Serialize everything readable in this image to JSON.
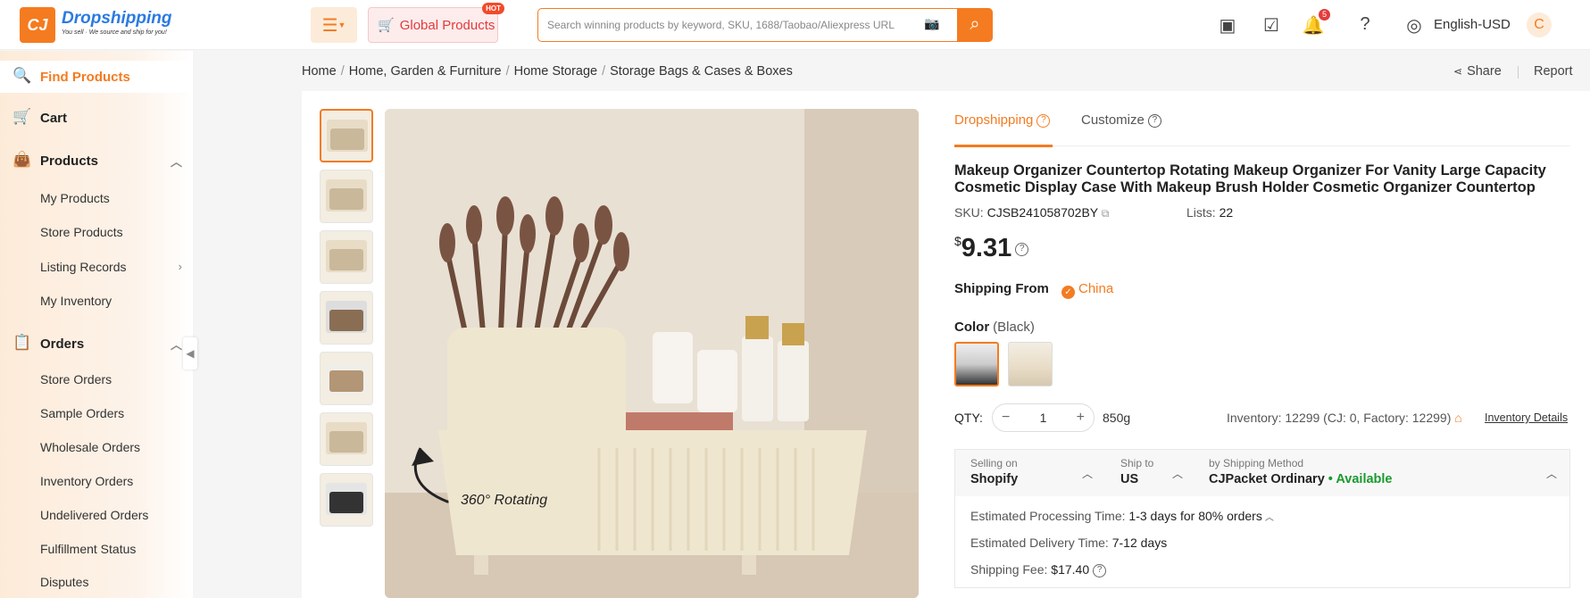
{
  "brand": {
    "name": "Dropshipping",
    "slogan": "You sell · We source and ship for you!",
    "logo_text": "CJ"
  },
  "header": {
    "global_products": "Global Products",
    "hot_badge": "HOT",
    "search_placeholder": "Search winning products by keyword, SKU, 1688/Taobao/Aliexpress URL",
    "notif_count": "5",
    "language": "English-USD",
    "avatar_letter": "C"
  },
  "sidebar": {
    "find_products": "Find Products",
    "cart": "Cart",
    "products": "Products",
    "products_sub": [
      "My Products",
      "Store Products",
      "Listing Records",
      "My Inventory"
    ],
    "orders": "Orders",
    "orders_sub": [
      "Store Orders",
      "Sample Orders",
      "Wholesale Orders",
      "Inventory Orders",
      "Undelivered Orders",
      "Fulfillment Status",
      "Disputes"
    ]
  },
  "breadcrumb": [
    "Home",
    "Home, Garden & Furniture",
    "Home Storage",
    "Storage Bags & Cases & Boxes"
  ],
  "actions": {
    "share": "Share",
    "report": "Report"
  },
  "image": {
    "overlay_text": "360° Rotating"
  },
  "tabs": {
    "dropshipping": "Dropshipping",
    "customize": "Customize"
  },
  "product": {
    "title": "Makeup Organizer Countertop Rotating Makeup Organizer For Vanity Large Capacity Cosmetic Display Case With Makeup Brush Holder Cosmetic Organizer Countertop",
    "sku_label": "SKU:",
    "sku": "CJSB241058702BY",
    "lists_label": "Lists:",
    "lists": "22",
    "currency": "$",
    "price": "9.31",
    "shipping_from_label": "Shipping From",
    "shipping_from": "China",
    "color_label": "Color",
    "color_value": "(Black)",
    "qty_label": "QTY:",
    "qty": "1",
    "weight": "850g",
    "inventory": "Inventory: 12299  (CJ: 0, Factory: 12299)",
    "inventory_details": "Inventory Details"
  },
  "shipping": {
    "selling_on_label": "Selling on",
    "selling_on": "Shopify",
    "ship_to_label": "Ship to",
    "ship_to": "US",
    "method_label": "by Shipping Method",
    "method": "CJPacket Ordinary",
    "available": "• Available",
    "processing_label": "Estimated Processing Time:",
    "processing": "1-3 days for 80% orders",
    "delivery_label": "Estimated Delivery Time:",
    "delivery": "7-12 days",
    "fee_label": "Shipping Fee:",
    "fee": "$17.40"
  },
  "colors": {
    "accent": "#f47b20",
    "link": "#2a7ae2",
    "available": "#1a9a2e"
  }
}
